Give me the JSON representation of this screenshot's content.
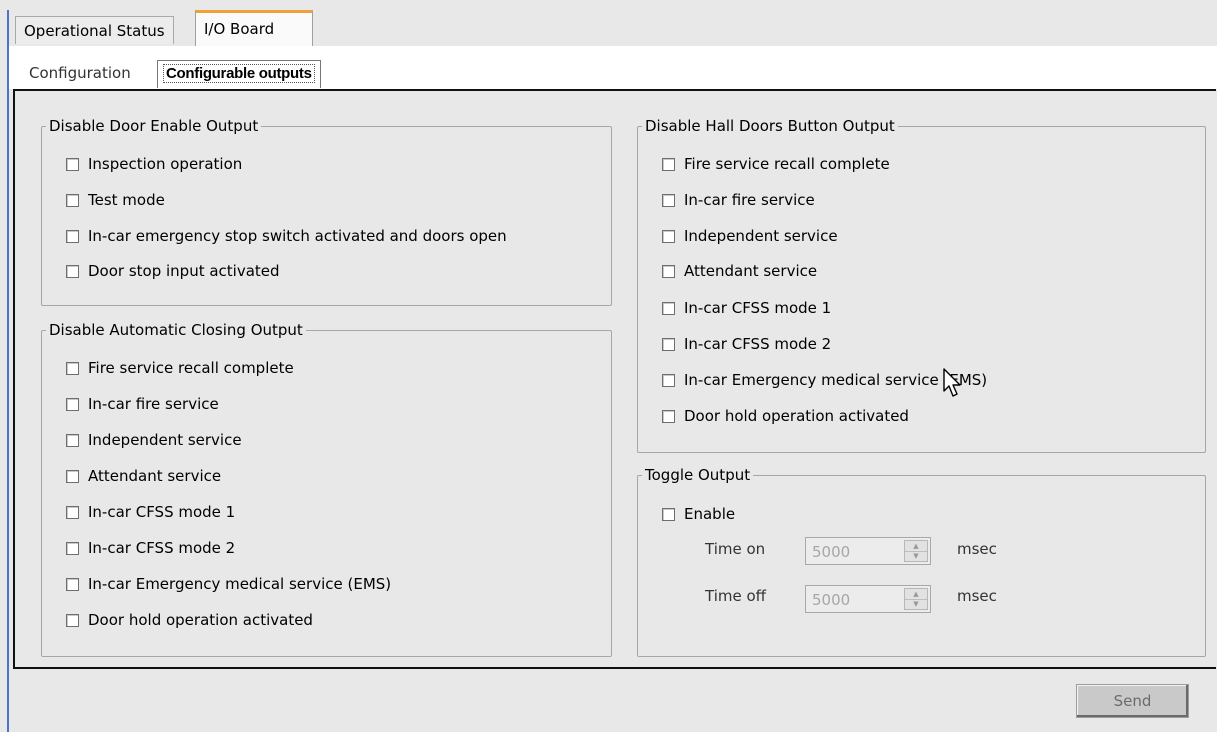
{
  "tabs": [
    "Operational Status",
    "I/O Board"
  ],
  "active_tab": "I/O Board",
  "subtabs": [
    "Configuration",
    "Configurable outputs"
  ],
  "active_subtab": "Configurable outputs",
  "groups": {
    "door_enable": {
      "title": "Disable Door Enable Output",
      "items": [
        "Inspection operation",
        "Test mode",
        "In-car emergency stop switch activated and doors open",
        "Door stop input activated"
      ]
    },
    "auto_closing": {
      "title": "Disable Automatic Closing Output",
      "items": [
        "Fire service recall complete",
        "In-car fire service",
        "Independent service",
        "Attendant service",
        "In-car CFSS mode 1",
        "In-car CFSS mode 2",
        "In-car Emergency medical service (EMS)",
        "Door hold operation activated"
      ]
    },
    "hall_doors": {
      "title": "Disable Hall Doors Button Output",
      "items": [
        "Fire service recall complete",
        "In-car fire service",
        "Independent service",
        "Attendant service",
        "In-car CFSS mode 1",
        "In-car CFSS mode 2",
        "In-car Emergency medical service (EMS)",
        "Door hold operation activated"
      ]
    },
    "toggle": {
      "title": "Toggle Output",
      "enable_label": "Enable",
      "time_on_label": "Time on",
      "time_on_value": "5000",
      "time_off_label": "Time off",
      "time_off_value": "5000",
      "unit": "msec"
    }
  },
  "send_label": "Send",
  "colors": {
    "accent_tab": "#f0a038",
    "left_accent": "#4a74c9",
    "panel_bg": "#e8e8e8"
  }
}
